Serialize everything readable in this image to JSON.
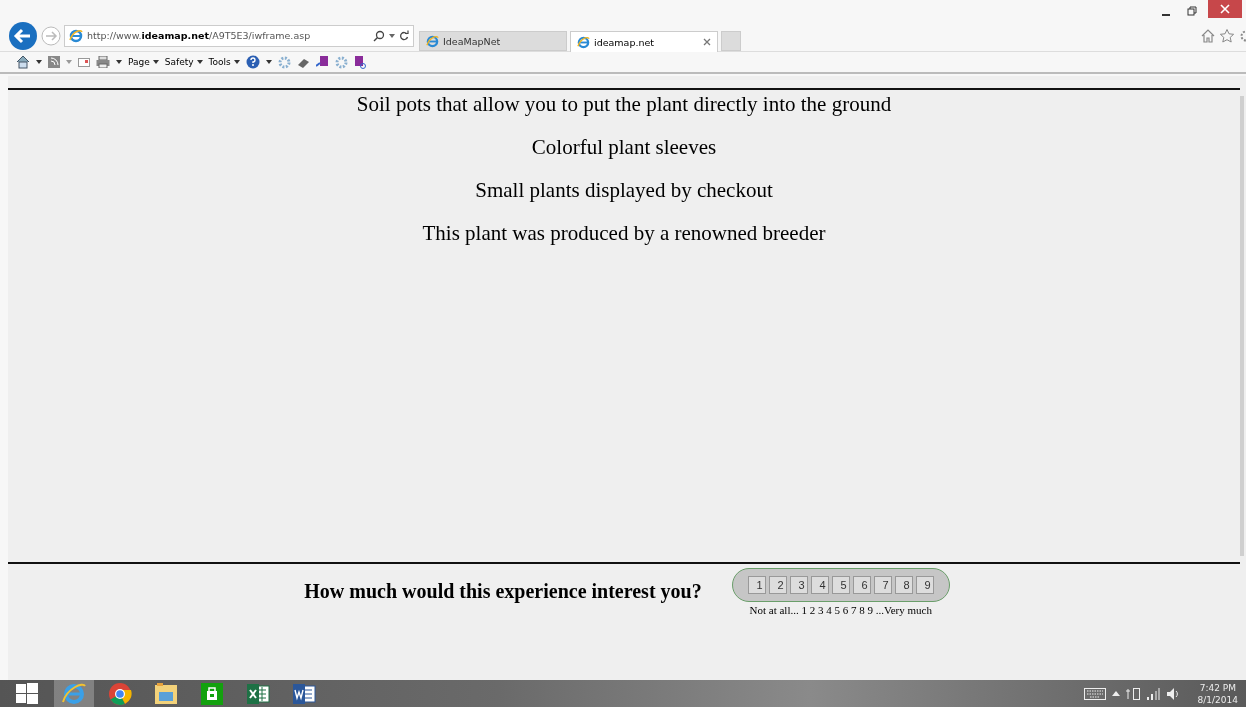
{
  "browser": {
    "address": "http://www.**ideamap.net**/A9T5E3/iwframe.asp",
    "tabs": [
      {
        "label": "IdeaMapNet",
        "selected": false
      },
      {
        "label": "ideamap.net",
        "selected": true
      }
    ],
    "menus": [
      "Page",
      "Safety",
      "Tools"
    ]
  },
  "content": {
    "items": [
      "Soil pots that allow you to put the plant directly into the ground",
      "Colorful plant sleeves",
      "Small plants displayed by checkout",
      "This plant was produced by a renowned breeder"
    ]
  },
  "question": {
    "text": "How much would this experience interest you?",
    "scale": [
      "1",
      "2",
      "3",
      "4",
      "5",
      "6",
      "7",
      "8",
      "9"
    ],
    "caption": "Not at all... 1 2 3 4 5 6 7 8 9 ...Very much"
  },
  "taskbar": {
    "apps": [
      {
        "kind": "ie",
        "selected": true
      },
      {
        "kind": "chrome",
        "selected": false
      },
      {
        "kind": "explorer",
        "selected": false
      },
      {
        "kind": "store",
        "selected": false
      },
      {
        "kind": "excel",
        "selected": false
      },
      {
        "kind": "word",
        "selected": false
      }
    ],
    "time": "7:42 PM",
    "date": "8/1/2014"
  }
}
